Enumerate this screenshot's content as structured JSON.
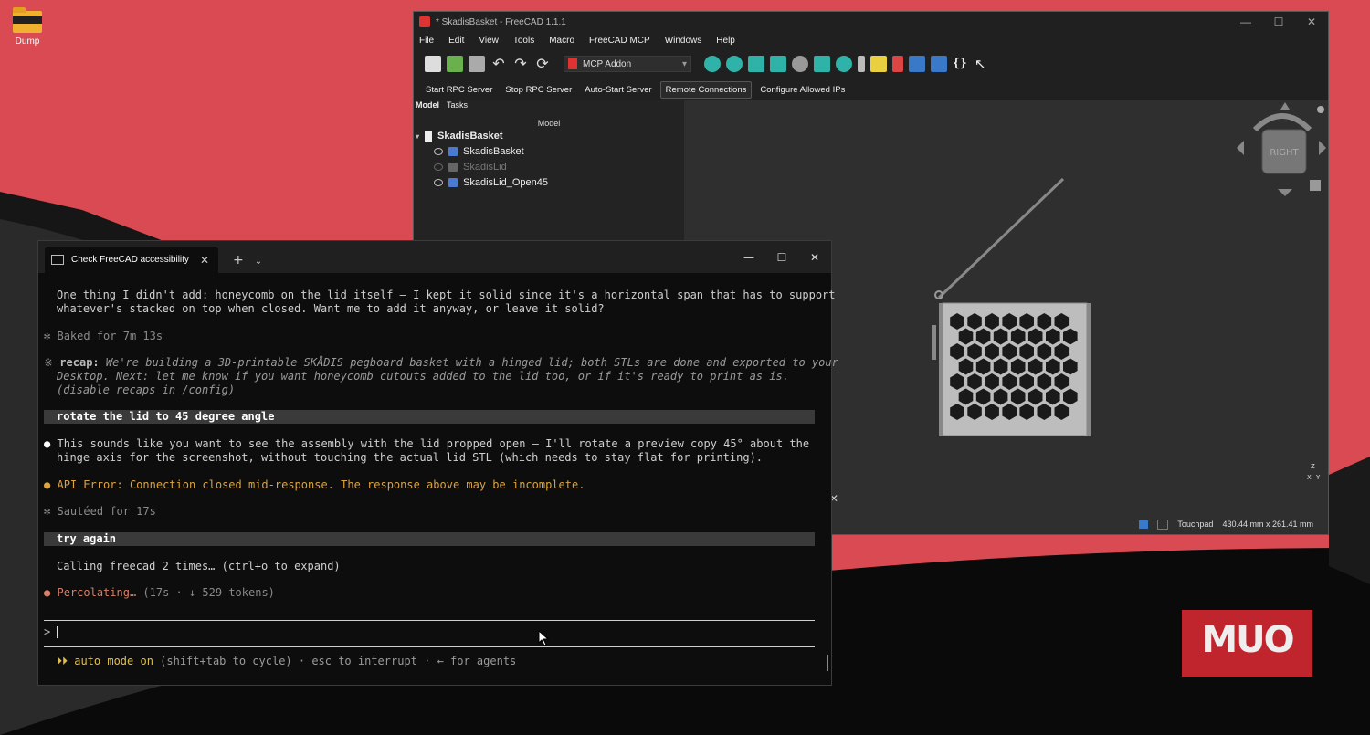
{
  "desktop": {
    "icon_label": "Dump"
  },
  "freecad": {
    "title": "* SkadisBasket - FreeCAD 1.1.1",
    "menu": [
      "File",
      "Edit",
      "View",
      "Tools",
      "Macro",
      "FreeCAD MCP",
      "Windows",
      "Help"
    ],
    "workbench": "MCP Addon",
    "rpc_buttons": [
      "Start RPC Server",
      "Stop RPC Server",
      "Auto-Start Server",
      "Remote Connections",
      "Configure Allowed IPs"
    ],
    "tabs": [
      "Model",
      "Tasks"
    ],
    "model_header": "Model",
    "tree": {
      "root": "SkadisBasket",
      "items": [
        "SkadisBasket",
        "SkadisLid",
        "SkadisLid_Open45"
      ]
    },
    "navcube_label": "RIGHT",
    "status": {
      "nav_mode": "Touchpad",
      "dimensions": "430.44 mm x 261.41 mm"
    }
  },
  "terminal": {
    "tab_title": "Check FreeCAD accessibility",
    "lines": {
      "l1": "One thing I didn't add: honeycomb on the lid itself — I kept it solid since it's a horizontal span that has to support",
      "l2": "whatever's stacked on top when closed. Want me to add it anyway, or leave it solid?",
      "baked": "Baked for 7m 13s",
      "recap_label": "recap:",
      "recap1": " We're building a 3D-printable SKÅDIS pegboard basket with a hinged lid; both STLs are done and exported to your",
      "recap2": "Desktop. Next: let me know if you want honeycomb cutouts added to the lid too, or if it's ready to print as is.",
      "recap3": "(disable recaps in /config)",
      "user1": "rotate the lid to 45 degree angle",
      "resp1": "This sounds like you want to see the assembly with the lid propped open — I'll rotate a preview copy 45° about the",
      "resp2": "hinge axis for the screenshot, without touching the actual lid STL (which needs to stay flat for printing).",
      "error": "API Error: Connection closed mid-response. The response above may be incomplete.",
      "sauteed": "Sautéed for 17s",
      "user2": "try again",
      "calling": "Calling freecad 2 times… (ctrl+o to expand)",
      "percolating": "Percolating…",
      "perc_stats": " (17s · ↓ 529 tokens)",
      "prompt": ">",
      "mode_arrows": "⏵⏵ auto mode on",
      "mode_rest": " (shift+tab to cycle) · esc to interrupt · ← for agents"
    }
  },
  "watermark": "MUO",
  "colors": {
    "desktop_red": "#d94a52",
    "terminal_bg": "#0d0d0d",
    "warning": "#d9a441",
    "progress": "#d67f6a",
    "freecad_dark": "#2b2b2b"
  }
}
